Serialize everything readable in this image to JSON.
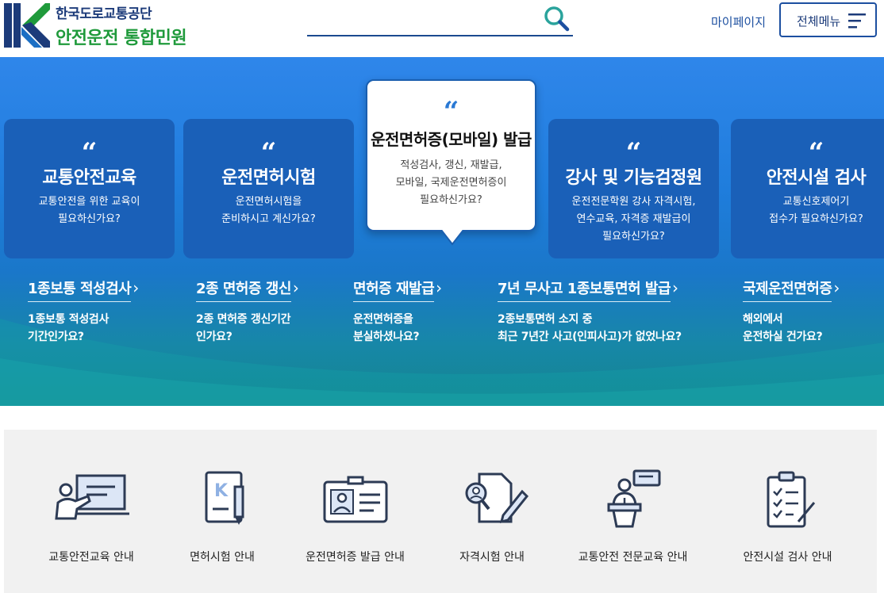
{
  "header": {
    "org_name": "한국도로교통공단",
    "site_name": "안전운전 통합민원",
    "search": {
      "placeholder": ""
    },
    "mypage": "마이페이지",
    "menu_label": "전체메뉴"
  },
  "colors": {
    "brand_navy": "#1c3b7a",
    "brand_green": "#1f9a3b",
    "hero_blue": "#2f86ea",
    "card_blue": "#1a60b8"
  },
  "cards": [
    {
      "quote": "“",
      "title": "교통안전교육",
      "desc": "교통안전을 위한 교육이\n필요하신가요?"
    },
    {
      "quote": "“",
      "title": "운전면허시험",
      "desc": "운전면허시험을\n준비하시고 계신가요?"
    },
    {
      "quote": "“",
      "title": "운전면허증(모바일) 발급",
      "desc": "적성검사, 갱신, 재발급,\n모바일, 국제운전면허증이\n필요하신가요?"
    },
    {
      "quote": "“",
      "title": "강사 및 기능검정원",
      "desc": "운전전문학원 강사 자격시험,\n연수교육, 자격증 재발급이\n필요하신가요?"
    },
    {
      "quote": "“",
      "title": "안전시설 검사",
      "desc": "교통신호제어기\n접수가 필요하신가요?"
    }
  ],
  "links": [
    {
      "label": "1종보통 적성검사",
      "arrow": "›",
      "desc": "1종보통 적성검사\n기간인가요?"
    },
    {
      "label": "2종 면허증 갱신",
      "arrow": "›",
      "desc": "2종 면허증 갱신기간\n인가요?"
    },
    {
      "label": "면허증 재발급",
      "arrow": "›",
      "desc": "운전면허증을\n분실하셨나요?"
    },
    {
      "label": "7년 무사고 1종보통면허 발급",
      "arrow": "›",
      "desc": "2종보통면허 소지 중\n최근 7년간 사고(인피사고)가 없었나요?"
    },
    {
      "label": "국제운전면허증",
      "arrow": "›",
      "desc": "해외에서\n운전하실 건가요?"
    }
  ],
  "guides": [
    {
      "label": "교통안전교육 안내",
      "icon": "teacher-board-icon"
    },
    {
      "label": "면허시험 안내",
      "icon": "document-pen-icon"
    },
    {
      "label": "운전면허증 발급 안내",
      "icon": "id-card-icon"
    },
    {
      "label": "자격시험 안내",
      "icon": "magnifier-pen-icon"
    },
    {
      "label": "교통안전 전문교육 안내",
      "icon": "lecturer-podium-icon"
    },
    {
      "label": "안전시설 검사 안내",
      "icon": "clipboard-checklist-icon"
    }
  ]
}
